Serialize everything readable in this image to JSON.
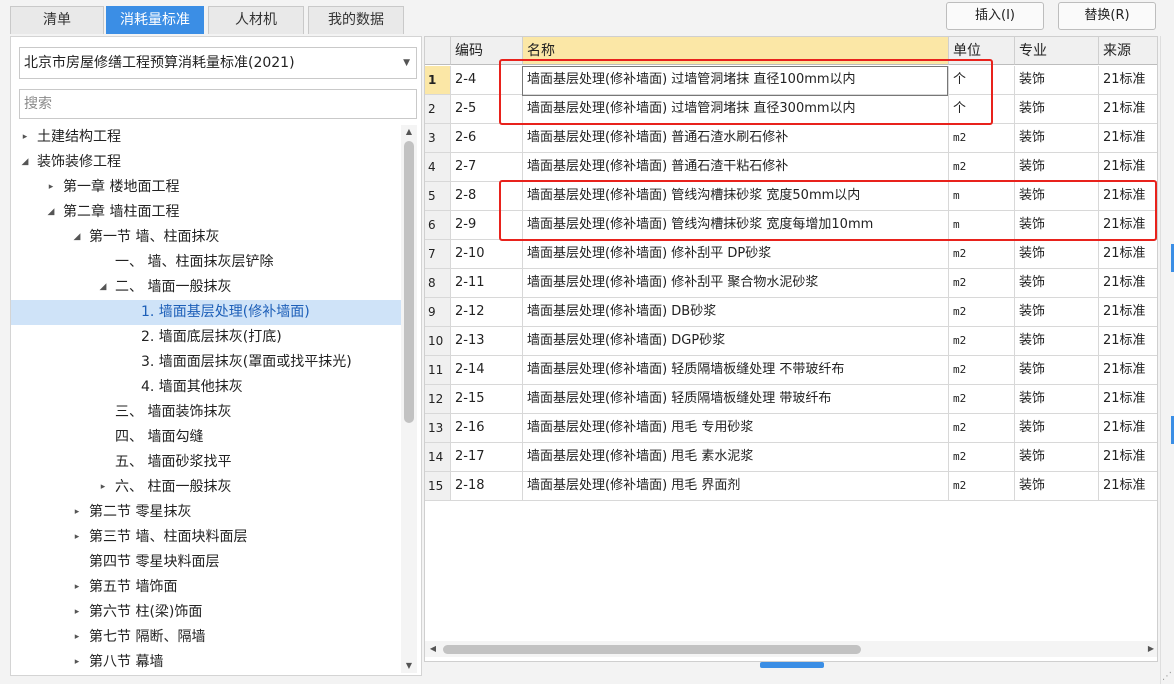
{
  "tabs": [
    {
      "label": "清单",
      "active": false
    },
    {
      "label": "消耗量标准",
      "active": true
    },
    {
      "label": "人材机",
      "active": false
    },
    {
      "label": "我的数据",
      "active": false
    }
  ],
  "toolbar": {
    "insert_label": "插入(I)",
    "replace_label": "替换(R)"
  },
  "left": {
    "standard": "北京市房屋修缮工程预算消耗量标准(2021)",
    "search_placeholder": "搜索",
    "tree": [
      {
        "label": "土建结构工程",
        "arrow": "▸"
      },
      {
        "label": "装饰装修工程",
        "arrow": "◢"
      },
      {
        "label": "第一章 楼地面工程",
        "arrow": "▸"
      },
      {
        "label": "第二章 墙柱面工程",
        "arrow": "◢"
      },
      {
        "label": "第一节 墙、柱面抹灰",
        "arrow": "◢"
      },
      {
        "label": "一、 墙、柱面抹灰层铲除",
        "arrow": ""
      },
      {
        "label": "二、 墙面一般抹灰",
        "arrow": "◢"
      },
      {
        "label": "1. 墙面基层处理(修补墙面)",
        "arrow": ""
      },
      {
        "label": "2. 墙面底层抹灰(打底)",
        "arrow": ""
      },
      {
        "label": "3. 墙面面层抹灰(罩面或找平抹光)",
        "arrow": ""
      },
      {
        "label": "4. 墙面其他抹灰",
        "arrow": ""
      },
      {
        "label": "三、 墙面装饰抹灰",
        "arrow": ""
      },
      {
        "label": "四、 墙面勾缝",
        "arrow": ""
      },
      {
        "label": "五、 墙面砂浆找平",
        "arrow": ""
      },
      {
        "label": "六、 柱面一般抹灰",
        "arrow": "▸"
      },
      {
        "label": "第二节 零星抹灰",
        "arrow": "▸"
      },
      {
        "label": "第三节 墙、柱面块料面层",
        "arrow": "▸"
      },
      {
        "label": "第四节 零星块料面层",
        "arrow": ""
      },
      {
        "label": "第五节 墙饰面",
        "arrow": "▸"
      },
      {
        "label": "第六节 柱(梁)饰面",
        "arrow": "▸"
      },
      {
        "label": "第七节 隔断、隔墙",
        "arrow": "▸"
      },
      {
        "label": "第八节 幕墙",
        "arrow": "▸"
      }
    ]
  },
  "table": {
    "headers": [
      "",
      "编码",
      "名称",
      "单位",
      "专业",
      "来源"
    ],
    "rows": [
      {
        "n": "1",
        "code": "2-4",
        "name": "墙面基层处理(修补墙面) 过墙管洞堵抹 直径100mm以内",
        "unit": "个",
        "major": "装饰",
        "source": "21标准"
      },
      {
        "n": "2",
        "code": "2-5",
        "name": "墙面基层处理(修补墙面) 过墙管洞堵抹 直径300mm以内",
        "unit": "个",
        "major": "装饰",
        "source": "21标准"
      },
      {
        "n": "3",
        "code": "2-6",
        "name": "墙面基层处理(修补墙面) 普通石渣水刷石修补",
        "unit": "m2",
        "major": "装饰",
        "source": "21标准"
      },
      {
        "n": "4",
        "code": "2-7",
        "name": "墙面基层处理(修补墙面) 普通石渣干粘石修补",
        "unit": "m2",
        "major": "装饰",
        "source": "21标准"
      },
      {
        "n": "5",
        "code": "2-8",
        "name": "墙面基层处理(修补墙面) 管线沟槽抹砂浆 宽度50mm以内",
        "unit": "m",
        "major": "装饰",
        "source": "21标准"
      },
      {
        "n": "6",
        "code": "2-9",
        "name": "墙面基层处理(修补墙面) 管线沟槽抹砂浆 宽度每增加10mm",
        "unit": "m",
        "major": "装饰",
        "source": "21标准"
      },
      {
        "n": "7",
        "code": "2-10",
        "name": "墙面基层处理(修补墙面) 修补刮平 DP砂浆",
        "unit": "m2",
        "major": "装饰",
        "source": "21标准"
      },
      {
        "n": "8",
        "code": "2-11",
        "name": "墙面基层处理(修补墙面) 修补刮平 聚合物水泥砂浆",
        "unit": "m2",
        "major": "装饰",
        "source": "21标准"
      },
      {
        "n": "9",
        "code": "2-12",
        "name": "墙面基层处理(修补墙面) DB砂浆",
        "unit": "m2",
        "major": "装饰",
        "source": "21标准"
      },
      {
        "n": "10",
        "code": "2-13",
        "name": "墙面基层处理(修补墙面) DGP砂浆",
        "unit": "m2",
        "major": "装饰",
        "source": "21标准"
      },
      {
        "n": "11",
        "code": "2-14",
        "name": "墙面基层处理(修补墙面) 轻质隔墙板缝处理 不带玻纤布",
        "unit": "m2",
        "major": "装饰",
        "source": "21标准"
      },
      {
        "n": "12",
        "code": "2-15",
        "name": "墙面基层处理(修补墙面) 轻质隔墙板缝处理 带玻纤布",
        "unit": "m2",
        "major": "装饰",
        "source": "21标准"
      },
      {
        "n": "13",
        "code": "2-16",
        "name": "墙面基层处理(修补墙面) 甩毛 专用砂浆",
        "unit": "m2",
        "major": "装饰",
        "source": "21标准"
      },
      {
        "n": "14",
        "code": "2-17",
        "name": "墙面基层处理(修补墙面) 甩毛 素水泥浆",
        "unit": "m2",
        "major": "装饰",
        "source": "21标准"
      },
      {
        "n": "15",
        "code": "2-18",
        "name": "墙面基层处理(修补墙面) 甩毛 界面剂",
        "unit": "m2",
        "major": "装饰",
        "source": "21标准"
      }
    ]
  }
}
